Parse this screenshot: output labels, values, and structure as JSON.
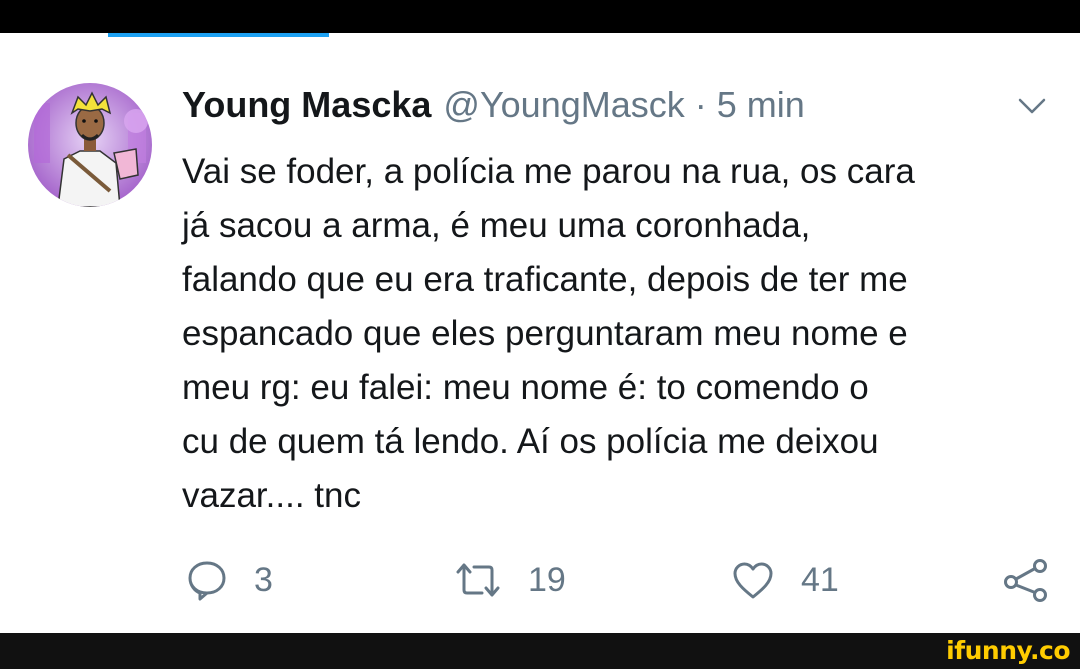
{
  "tweet": {
    "author": {
      "display_name": "Young Mascka",
      "handle": "@YoungMasck",
      "avatar_icon": "avatar-cartoon-icon"
    },
    "separator": "·",
    "timestamp": "5 min",
    "text": "Vai se foder, a polícia me parou na rua, os cara\njá sacou a arma, é meu uma coronhada,\nfalando que eu era traficante, depois de ter me\nespancado que eles perguntaram meu nome e\nmeu rg: eu falei: meu nome é: to comendo o\ncu de quem tá lendo. Aí os polícia me deixou\nvazar.... tnc",
    "actions": {
      "reply": {
        "icon": "reply-icon",
        "count": "3"
      },
      "retweet": {
        "icon": "retweet-icon",
        "count": "19"
      },
      "like": {
        "icon": "heart-icon",
        "count": "41"
      },
      "share": {
        "icon": "share-icon"
      }
    },
    "menu_icon": "chevron-down-icon"
  },
  "watermark": "ifunny.co",
  "colors": {
    "text_primary": "#14171a",
    "text_secondary": "#657786",
    "accent": "#1da1f2",
    "watermark": "#ffcc00"
  }
}
